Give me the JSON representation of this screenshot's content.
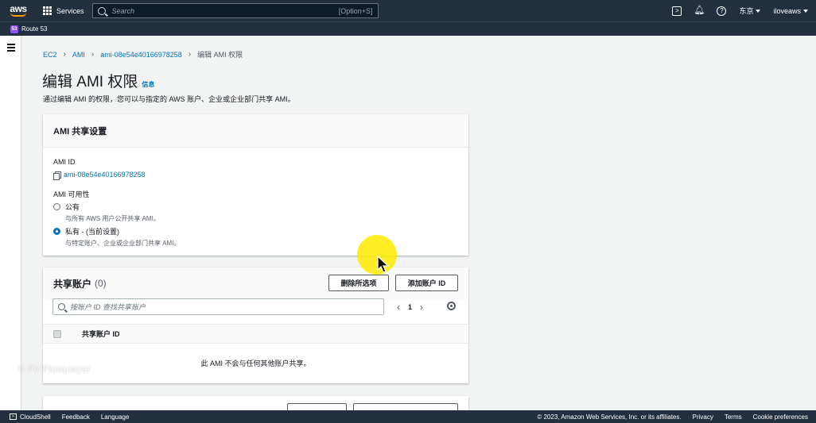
{
  "nav": {
    "logo": "aws",
    "services_label": "Services",
    "search_placeholder": "Search",
    "search_shortcut": "[Option+S]",
    "region": "东京",
    "account": "iloveaws"
  },
  "subnav": {
    "service_label": "Route 53"
  },
  "breadcrumb": [
    "EC2",
    "AMI",
    "ami-08e54e40166978258",
    "编辑 AMI 权限"
  ],
  "page": {
    "title": "编辑 AMI 权限",
    "info_link": "信息",
    "description": "通过编辑 AMI 的权限，您可以与指定的 AWS 账户、企业或企业部门共享 AMI。"
  },
  "sharing_settings": {
    "header": "AMI 共享设置",
    "ami_id_label": "AMI ID",
    "ami_id": "ami-08e54e40166978258",
    "availability_label": "AMI 可用性",
    "public_label": "公有",
    "public_desc": "与所有 AWS 用户公开共享 AMI。",
    "private_label": "私有 - (当前设置)",
    "private_desc": "与特定账户、企业或企业部门共享 AMI。",
    "selected": "private"
  },
  "shared_accounts": {
    "title": "共享账户",
    "count": "(0)",
    "remove_button": "删除所选项",
    "add_button": "添加账户 ID",
    "filter_placeholder": "按账户 ID 查找共享账户",
    "page_number": "1",
    "column_header": "共享账户 ID",
    "empty_message": "此 AMI 不会与任何其他账户共享。"
  },
  "watermark": "© FV Flowplayer",
  "footer": {
    "cloudshell": "CloudShell",
    "feedback": "Feedback",
    "language": "Language",
    "copyright": "© 2023, Amazon Web Services, Inc. or its affiliates.",
    "privacy": "Privacy",
    "terms": "Terms",
    "cookie": "Cookie preferences"
  },
  "colors": {
    "nav_bg": "#232f3e",
    "link": "#0073bb",
    "page_bg": "#f2f3f3",
    "cursor_highlight": "#ffeb00"
  }
}
